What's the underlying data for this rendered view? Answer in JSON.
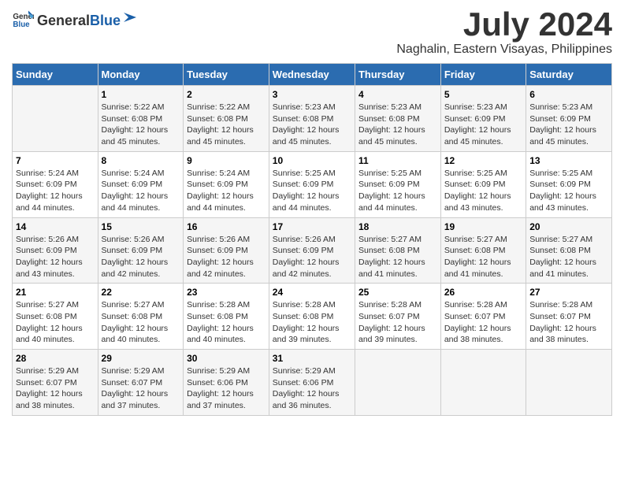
{
  "logo": {
    "general": "General",
    "blue": "Blue"
  },
  "title": {
    "month": "July 2024",
    "location": "Naghalin, Eastern Visayas, Philippines"
  },
  "headers": [
    "Sunday",
    "Monday",
    "Tuesday",
    "Wednesday",
    "Thursday",
    "Friday",
    "Saturday"
  ],
  "weeks": [
    [
      {
        "day": "",
        "info": ""
      },
      {
        "day": "1",
        "info": "Sunrise: 5:22 AM\nSunset: 6:08 PM\nDaylight: 12 hours\nand 45 minutes."
      },
      {
        "day": "2",
        "info": "Sunrise: 5:22 AM\nSunset: 6:08 PM\nDaylight: 12 hours\nand 45 minutes."
      },
      {
        "day": "3",
        "info": "Sunrise: 5:23 AM\nSunset: 6:08 PM\nDaylight: 12 hours\nand 45 minutes."
      },
      {
        "day": "4",
        "info": "Sunrise: 5:23 AM\nSunset: 6:08 PM\nDaylight: 12 hours\nand 45 minutes."
      },
      {
        "day": "5",
        "info": "Sunrise: 5:23 AM\nSunset: 6:09 PM\nDaylight: 12 hours\nand 45 minutes."
      },
      {
        "day": "6",
        "info": "Sunrise: 5:23 AM\nSunset: 6:09 PM\nDaylight: 12 hours\nand 45 minutes."
      }
    ],
    [
      {
        "day": "7",
        "info": "Sunrise: 5:24 AM\nSunset: 6:09 PM\nDaylight: 12 hours\nand 44 minutes."
      },
      {
        "day": "8",
        "info": "Sunrise: 5:24 AM\nSunset: 6:09 PM\nDaylight: 12 hours\nand 44 minutes."
      },
      {
        "day": "9",
        "info": "Sunrise: 5:24 AM\nSunset: 6:09 PM\nDaylight: 12 hours\nand 44 minutes."
      },
      {
        "day": "10",
        "info": "Sunrise: 5:25 AM\nSunset: 6:09 PM\nDaylight: 12 hours\nand 44 minutes."
      },
      {
        "day": "11",
        "info": "Sunrise: 5:25 AM\nSunset: 6:09 PM\nDaylight: 12 hours\nand 44 minutes."
      },
      {
        "day": "12",
        "info": "Sunrise: 5:25 AM\nSunset: 6:09 PM\nDaylight: 12 hours\nand 43 minutes."
      },
      {
        "day": "13",
        "info": "Sunrise: 5:25 AM\nSunset: 6:09 PM\nDaylight: 12 hours\nand 43 minutes."
      }
    ],
    [
      {
        "day": "14",
        "info": "Sunrise: 5:26 AM\nSunset: 6:09 PM\nDaylight: 12 hours\nand 43 minutes."
      },
      {
        "day": "15",
        "info": "Sunrise: 5:26 AM\nSunset: 6:09 PM\nDaylight: 12 hours\nand 42 minutes."
      },
      {
        "day": "16",
        "info": "Sunrise: 5:26 AM\nSunset: 6:09 PM\nDaylight: 12 hours\nand 42 minutes."
      },
      {
        "day": "17",
        "info": "Sunrise: 5:26 AM\nSunset: 6:09 PM\nDaylight: 12 hours\nand 42 minutes."
      },
      {
        "day": "18",
        "info": "Sunrise: 5:27 AM\nSunset: 6:08 PM\nDaylight: 12 hours\nand 41 minutes."
      },
      {
        "day": "19",
        "info": "Sunrise: 5:27 AM\nSunset: 6:08 PM\nDaylight: 12 hours\nand 41 minutes."
      },
      {
        "day": "20",
        "info": "Sunrise: 5:27 AM\nSunset: 6:08 PM\nDaylight: 12 hours\nand 41 minutes."
      }
    ],
    [
      {
        "day": "21",
        "info": "Sunrise: 5:27 AM\nSunset: 6:08 PM\nDaylight: 12 hours\nand 40 minutes."
      },
      {
        "day": "22",
        "info": "Sunrise: 5:27 AM\nSunset: 6:08 PM\nDaylight: 12 hours\nand 40 minutes."
      },
      {
        "day": "23",
        "info": "Sunrise: 5:28 AM\nSunset: 6:08 PM\nDaylight: 12 hours\nand 40 minutes."
      },
      {
        "day": "24",
        "info": "Sunrise: 5:28 AM\nSunset: 6:08 PM\nDaylight: 12 hours\nand 39 minutes."
      },
      {
        "day": "25",
        "info": "Sunrise: 5:28 AM\nSunset: 6:07 PM\nDaylight: 12 hours\nand 39 minutes."
      },
      {
        "day": "26",
        "info": "Sunrise: 5:28 AM\nSunset: 6:07 PM\nDaylight: 12 hours\nand 38 minutes."
      },
      {
        "day": "27",
        "info": "Sunrise: 5:28 AM\nSunset: 6:07 PM\nDaylight: 12 hours\nand 38 minutes."
      }
    ],
    [
      {
        "day": "28",
        "info": "Sunrise: 5:29 AM\nSunset: 6:07 PM\nDaylight: 12 hours\nand 38 minutes."
      },
      {
        "day": "29",
        "info": "Sunrise: 5:29 AM\nSunset: 6:07 PM\nDaylight: 12 hours\nand 37 minutes."
      },
      {
        "day": "30",
        "info": "Sunrise: 5:29 AM\nSunset: 6:06 PM\nDaylight: 12 hours\nand 37 minutes."
      },
      {
        "day": "31",
        "info": "Sunrise: 5:29 AM\nSunset: 6:06 PM\nDaylight: 12 hours\nand 36 minutes."
      },
      {
        "day": "",
        "info": ""
      },
      {
        "day": "",
        "info": ""
      },
      {
        "day": "",
        "info": ""
      }
    ]
  ]
}
